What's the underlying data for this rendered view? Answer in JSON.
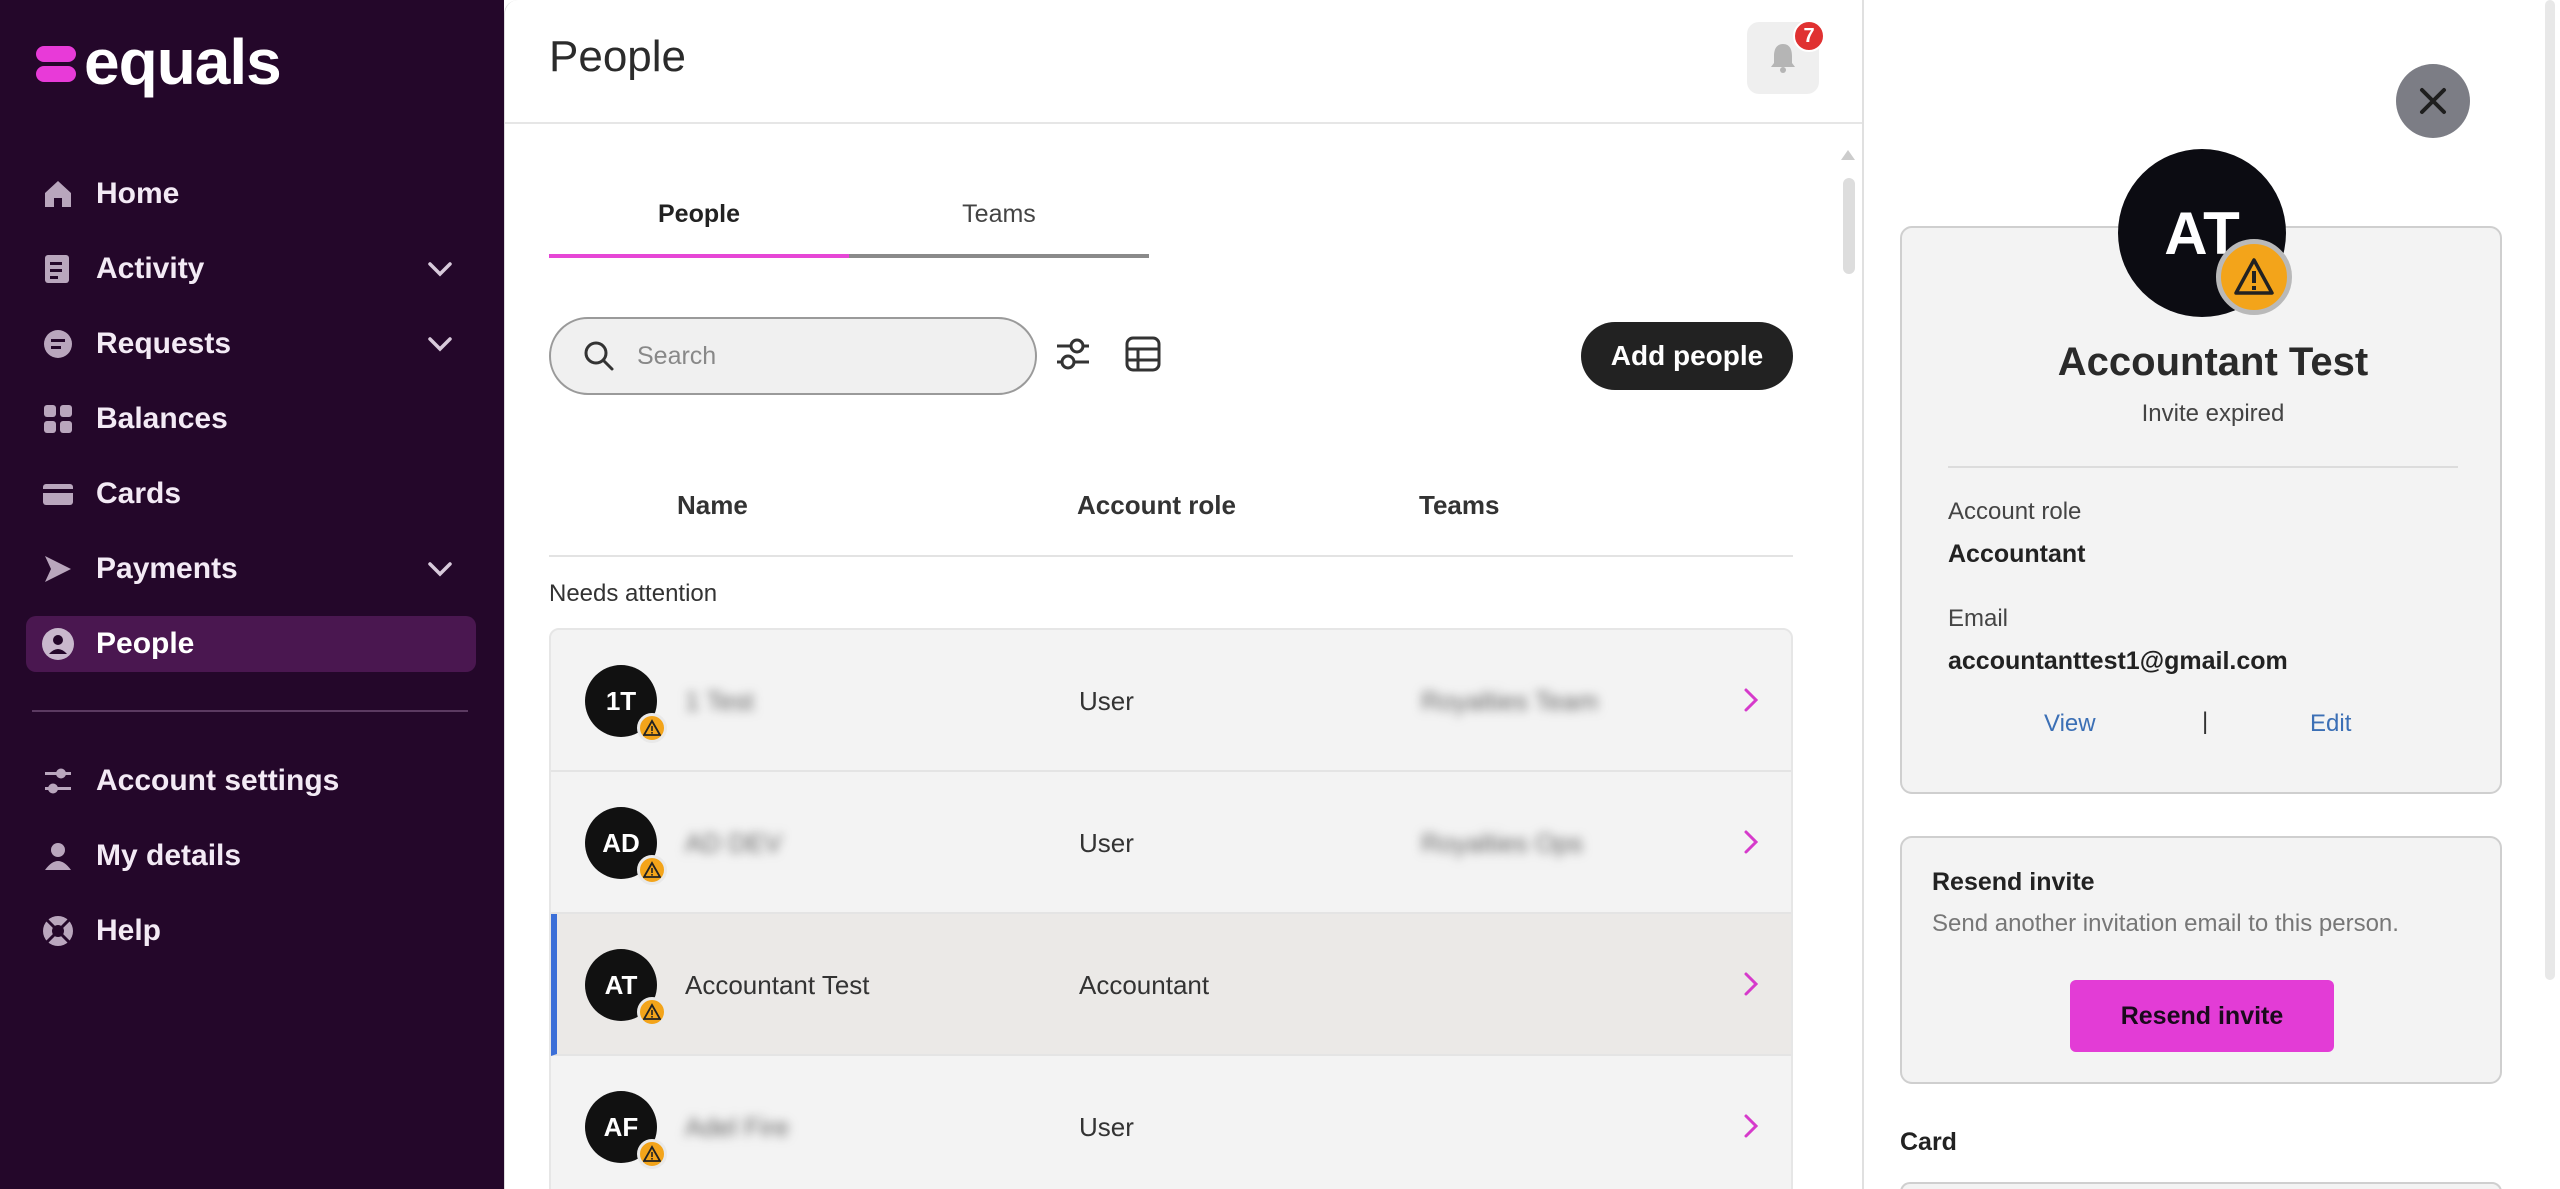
{
  "brand": {
    "name": "equals",
    "accent": "#e83ad8",
    "sidebar_bg": "#24072a"
  },
  "sidebar": {
    "items": [
      {
        "label": "Home",
        "icon": "home-icon"
      },
      {
        "label": "Activity",
        "icon": "activity-icon",
        "expandable": true
      },
      {
        "label": "Requests",
        "icon": "requests-icon",
        "expandable": true
      },
      {
        "label": "Balances",
        "icon": "balances-icon"
      },
      {
        "label": "Cards",
        "icon": "card-icon"
      },
      {
        "label": "Payments",
        "icon": "payments-icon",
        "expandable": true
      },
      {
        "label": "People",
        "icon": "person-icon",
        "active": true
      }
    ],
    "bottom_items": [
      {
        "label": "Account settings",
        "icon": "settings-icon"
      },
      {
        "label": "My details",
        "icon": "user-icon"
      },
      {
        "label": "Help",
        "icon": "help-icon"
      }
    ]
  },
  "header": {
    "title": "People",
    "notification_count": "7"
  },
  "tabs": [
    {
      "label": "People",
      "active": true
    },
    {
      "label": "Teams",
      "active": false
    }
  ],
  "toolbar": {
    "search_placeholder": "Search",
    "add_label": "Add people"
  },
  "table": {
    "columns": [
      "Name",
      "Account role",
      "Teams"
    ],
    "section_label": "Needs attention",
    "rows": [
      {
        "initials": "1T",
        "name": "1 Test",
        "name_blurred": true,
        "role": "User",
        "team": "Royalties Team"
      },
      {
        "initials": "AD",
        "name": "AD DEV",
        "name_blurred": true,
        "role": "User",
        "team": "Royalties Ops"
      },
      {
        "initials": "AT",
        "name": "Accountant Test",
        "name_blurred": false,
        "role": "Accountant",
        "team": "",
        "selected": true
      },
      {
        "initials": "AF",
        "name": "Adel Fire",
        "name_blurred": true,
        "role": "User",
        "team": ""
      }
    ]
  },
  "panel": {
    "initials": "AT",
    "name": "Accountant Test",
    "status": "Invite expired",
    "account_role_label": "Account role",
    "account_role": "Accountant",
    "email_label": "Email",
    "email": "accountanttest1@gmail.com",
    "view_label": "View",
    "separator": "|",
    "edit_label": "Edit",
    "resend": {
      "title": "Resend invite",
      "description": "Send another invitation email to this person.",
      "button": "Resend invite"
    },
    "card_heading": "Card"
  }
}
